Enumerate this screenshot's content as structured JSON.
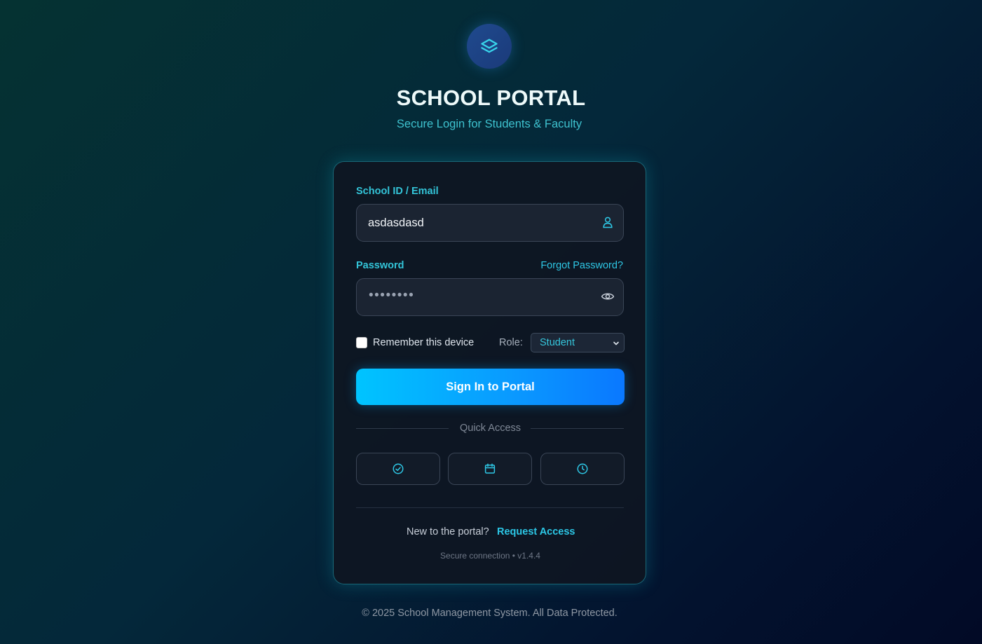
{
  "header": {
    "logo_icon": "layers-icon",
    "title": "SCHOOL PORTAL",
    "subtitle": "Secure Login for Students & Faculty"
  },
  "form": {
    "id_label": "School ID / Email",
    "id_value": "asdasdasd",
    "id_icon": "user-icon",
    "password_label": "Password",
    "forgot_label": "Forgot Password?",
    "password_masked": "••••••••",
    "password_icon": "eye-icon",
    "remember_label": "Remember this device",
    "remember_checked": false,
    "role_label": "Role:",
    "role_value": "Student",
    "signin_label": "Sign In to Portal"
  },
  "quick_access": {
    "label": "Quick Access",
    "buttons": [
      {
        "icon": "check-circle-icon"
      },
      {
        "icon": "calendar-icon"
      },
      {
        "icon": "clock-icon"
      }
    ]
  },
  "card_footer": {
    "new_text": "New to the portal?",
    "request_label": "Request Access",
    "secure_text": "Secure connection • v1.4.4"
  },
  "footer": {
    "copyright": "© 2025 School Management System. All Data Protected."
  },
  "colors": {
    "accent": "#2ec8e6",
    "button_start": "#00c4ff",
    "button_end": "#0a78ff"
  }
}
